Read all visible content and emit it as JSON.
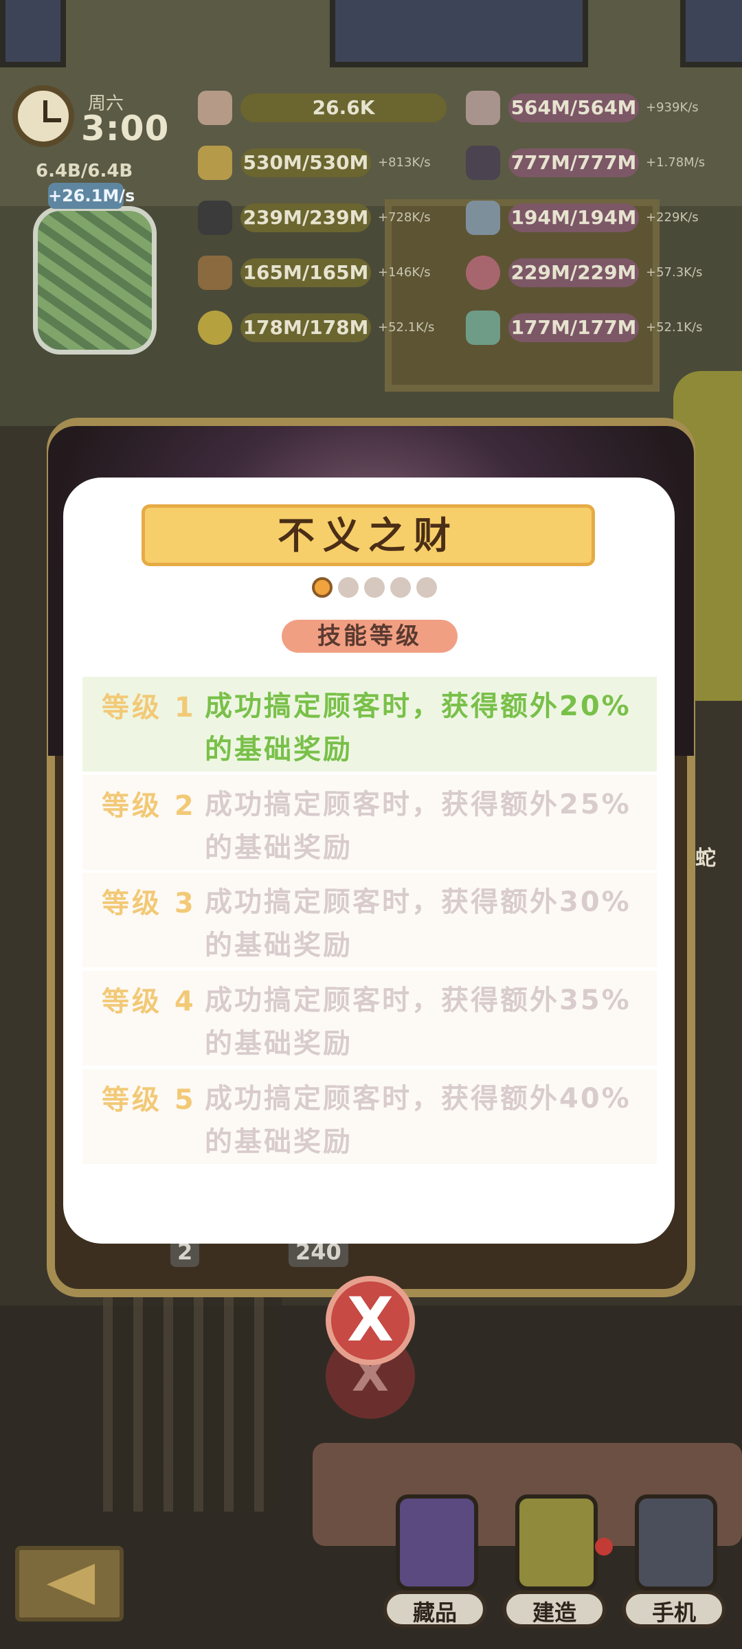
{
  "hud": {
    "day": "周六",
    "time": "3:00",
    "jar": {
      "capacity": "6.4B/6.4B",
      "rate": "+26.1M/s"
    },
    "resources_left": [
      {
        "icon": "peach-icon",
        "value": "26.6K",
        "rate": ""
      },
      {
        "icon": "gold-bar-icon",
        "value": "530M/530M",
        "rate": "+813K/s"
      },
      {
        "icon": "coal-icon",
        "value": "239M/239M",
        "rate": "+728K/s"
      },
      {
        "icon": "wood-plank-icon",
        "value": "165M/165M",
        "rate": "+146K/s"
      },
      {
        "icon": "banana-icon",
        "value": "178M/178M",
        "rate": "+52.1K/s"
      }
    ],
    "resources_right": [
      {
        "icon": "chart-icon",
        "value": "564M/564M",
        "rate": "+939K/s"
      },
      {
        "icon": "cards-icon",
        "value": "777M/777M",
        "rate": "+1.78M/s"
      },
      {
        "icon": "bottle-icon",
        "value": "194M/194M",
        "rate": "+229K/s"
      },
      {
        "icon": "heart-icon",
        "value": "229M/229M",
        "rate": "+57.3K/s"
      },
      {
        "icon": "jar-face-icon",
        "value": "177M/177M",
        "rate": "+52.1K/s"
      }
    ]
  },
  "modal": {
    "title": "不义之财",
    "page_count": 5,
    "current_page": 1,
    "skill_label": "技能等级",
    "levels": [
      {
        "label": "等级 1",
        "desc": "成功搞定顾客时，获得额外20%的基础奖励",
        "active": true
      },
      {
        "label": "等级 2",
        "desc": "成功搞定顾客时，获得额外25%的基础奖励",
        "active": false
      },
      {
        "label": "等级 3",
        "desc": "成功搞定顾客时，获得额外30%的基础奖励",
        "active": false
      },
      {
        "label": "等级 4",
        "desc": "成功搞定顾客时，获得额外35%的基础奖励",
        "active": false
      },
      {
        "label": "等级 5",
        "desc": "成功搞定顾客时，获得额外40%的基础奖励",
        "active": false
      }
    ],
    "close": "X",
    "under_values": [
      "2",
      "240"
    ]
  },
  "side_text": "蛇",
  "bottom_nav": {
    "collection": "藏品",
    "build": "建造",
    "phone": "手机"
  },
  "colors": {
    "active_text": "#79c049",
    "level_label": "#f2c977",
    "title_plate": "#f7cf6a",
    "close_button": "#c74a44"
  }
}
